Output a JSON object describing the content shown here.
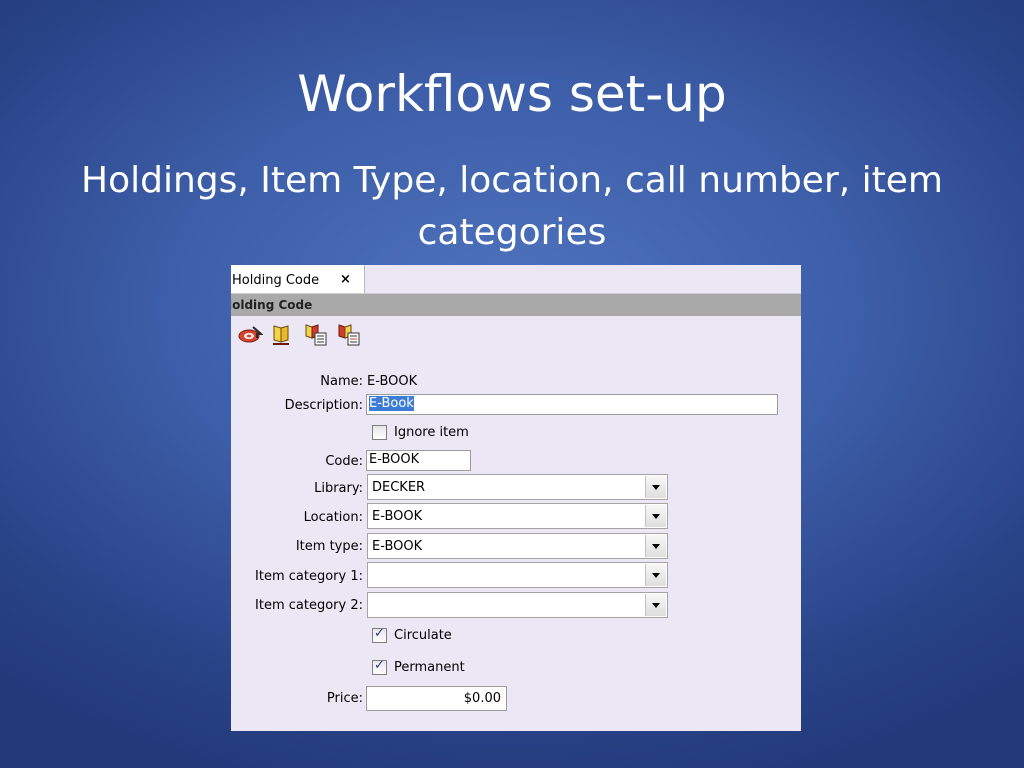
{
  "slide": {
    "title": "Workflows set-up",
    "subtitle": "Holdings, Item Type, location, call number, item categories"
  },
  "window": {
    "tab_label": "Holding Code",
    "tab_close": "×",
    "section_label": "lolding Code",
    "toolbar_icons": [
      "refresh-target-icon",
      "book-icon",
      "book-list-icon",
      "book-list-delete-icon"
    ]
  },
  "form": {
    "name": {
      "label": "Name:",
      "value": "E-BOOK"
    },
    "description": {
      "label": "Description:",
      "value": "E-Book"
    },
    "ignore_item": {
      "label": "Ignore item",
      "checked": false
    },
    "code": {
      "label": "Code:",
      "value": "E-BOOK"
    },
    "library": {
      "label": "Library:",
      "value": "DECKER"
    },
    "location": {
      "label": "Location:",
      "value": "E-BOOK"
    },
    "item_type": {
      "label": "Item type:",
      "value": "E-BOOK"
    },
    "item_category_1": {
      "label": "Item category 1:",
      "value": ""
    },
    "item_category_2": {
      "label": "Item category 2:",
      "value": ""
    },
    "circulate": {
      "label": "Circulate",
      "checked": true,
      "mark": "✓"
    },
    "permanent": {
      "label": "Permanent",
      "checked": true,
      "mark": "✓"
    },
    "price": {
      "label": "Price:",
      "value": "$0.00"
    }
  }
}
